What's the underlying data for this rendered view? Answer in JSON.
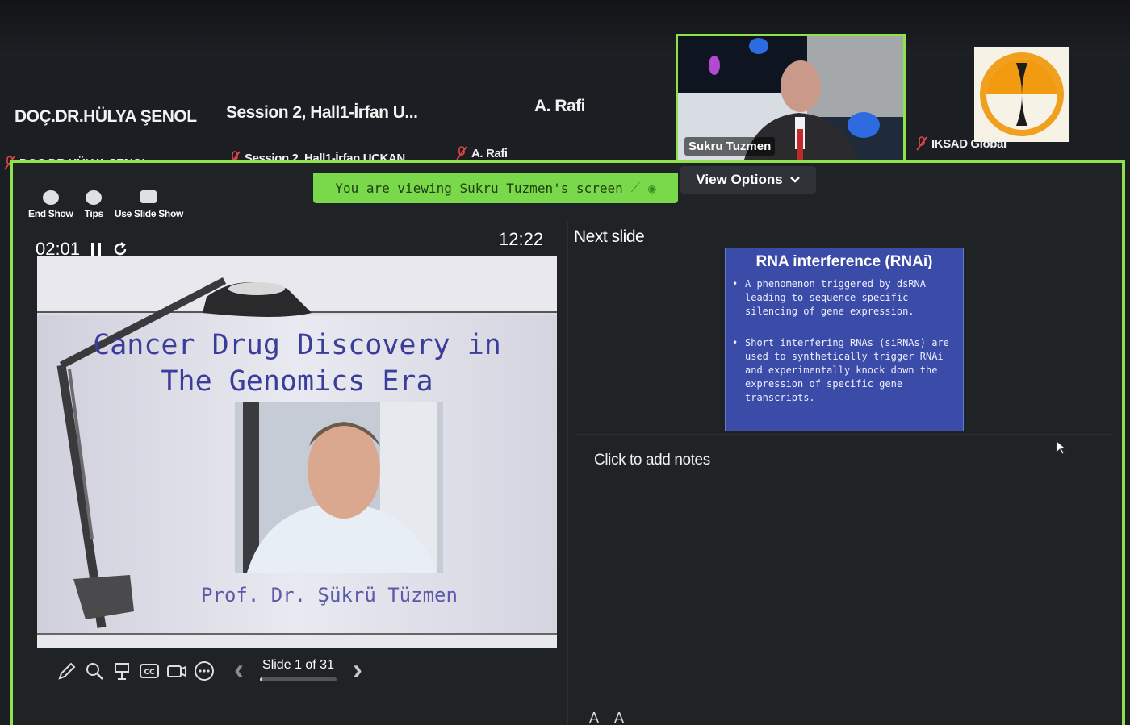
{
  "participants_top": [
    {
      "name": "DOÇ.DR.HÜLYA ŞENOL"
    },
    {
      "name": "Session 2, Hall1-İrfan U..."
    },
    {
      "name": "A. Rafi"
    }
  ],
  "participants_labels": [
    {
      "name": "DOÇ.DR.HÜLYA ŞENOL"
    },
    {
      "name": "Session 2. Hall1-İrfan UÇKAN"
    },
    {
      "name": "A. Rafi"
    }
  ],
  "speaker": {
    "name": "Sukru Tuzmen"
  },
  "iksad": {
    "name": "IKSAD Global"
  },
  "view_options": {
    "label": "View Options"
  },
  "viewing_banner": {
    "text": "You are viewing  Sukru Tuzmen's screen"
  },
  "presenter_toolbar": {
    "end_show": "End Show",
    "tips": "Tips",
    "use_slide_show": "Use Slide Show"
  },
  "timer": {
    "elapsed": "02:01",
    "clock": "12:22"
  },
  "current_slide": {
    "title_line1": "Cancer Drug Discovery in",
    "title_line2": "The Genomics Era",
    "author": "Prof. Dr. Şükrü Tüzmen"
  },
  "next_slide": {
    "heading": "Next slide",
    "title": "RNA interference (RNAi)",
    "bullets": [
      "A phenomenon triggered by dsRNA leading to sequence specific silencing of gene expression.",
      "Short interfering RNAs (siRNAs) are used to synthetically trigger RNAi and experimentally knock down the expression of specific gene transcripts."
    ]
  },
  "notes": {
    "placeholder": "Click to add notes"
  },
  "slide_nav": {
    "label": "Slide 1 of 31",
    "current": 1,
    "total": 31
  },
  "font_controls": "A A",
  "colors": {
    "accent_green": "#8fe24a",
    "banner_green": "#7ad84b",
    "slide_blue": "#3a4ba8"
  }
}
